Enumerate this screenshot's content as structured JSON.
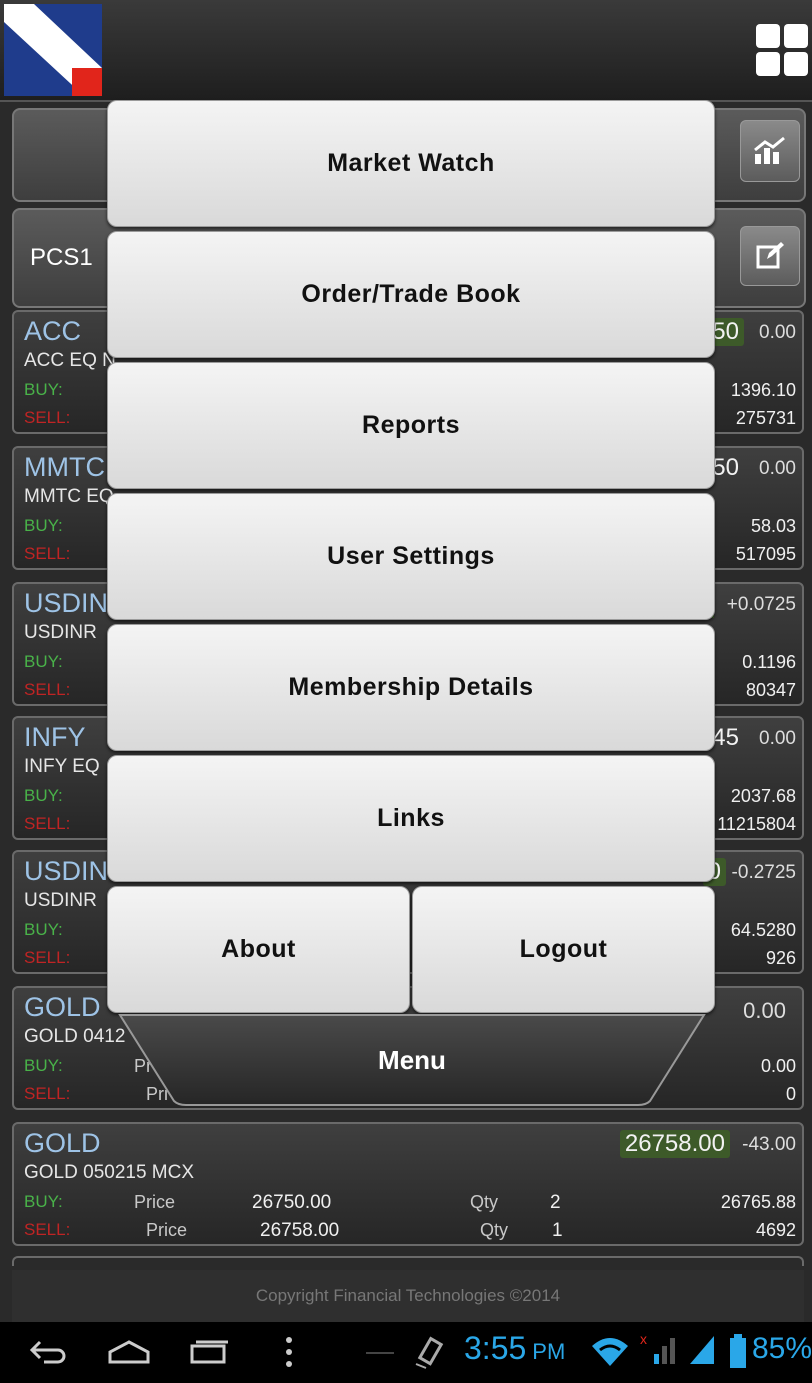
{
  "header": {
    "logo": "brand-logo",
    "menu_icon": "grid-icon"
  },
  "toolbar": {
    "chart_icon": "chart-icon",
    "edit_icon": "edit-icon",
    "watchlist_name": "PCS1"
  },
  "labels": {
    "buy": "BUY:",
    "sell": "SELL:",
    "price": "Price",
    "qty": "Qty"
  },
  "watchlist": [
    {
      "symbol": "ACC",
      "desc": "ACC EQ N",
      "ltp": ".50",
      "change": "0.00",
      "buy_right": "1396.10",
      "sell_right": "275731"
    },
    {
      "symbol": "MMTC",
      "desc": "MMTC EQ",
      "ltp": ".50",
      "change": "0.00",
      "buy_right": "58.03",
      "sell_right": "517095"
    },
    {
      "symbol": "USDIN",
      "desc": "USDINR",
      "ltp": "",
      "change": "+0.0725",
      "buy_right": "0.1196",
      "sell_right": "80347"
    },
    {
      "symbol": "INFY",
      "desc": "INFY EQ",
      "ltp": ".45",
      "change": "0.00",
      "buy_right": "2037.68",
      "sell_right": "11215804"
    },
    {
      "symbol": "USDIN",
      "desc": "USDINR",
      "ltp": "0",
      "change": "-0.2725",
      "buy_right": "64.5280",
      "sell_right": "926"
    },
    {
      "symbol": "GOLD",
      "desc": "GOLD 0412",
      "ltp": "",
      "change": "0.00",
      "buy_right": "0.00",
      "sell_right": "0",
      "buy_price_lbl": "Pr",
      "sell_price_lbl": "Pri"
    },
    {
      "symbol": "GOLD",
      "desc": "GOLD 050215 MCX",
      "ltp": "26758.00",
      "change": "-43.00",
      "buy_price": "26750.00",
      "buy_qty": "2",
      "buy_right": "26765.88",
      "sell_price": "26758.00",
      "sell_qty": "1",
      "sell_right": "4692"
    }
  ],
  "footer": {
    "copyright": "Copyright Financial Technologies ©2014"
  },
  "menu": {
    "items": [
      "Market Watch",
      "Order/Trade Book",
      "Reports",
      "User Settings",
      "Membership Details",
      "Links"
    ],
    "about": "About",
    "logout": "Logout",
    "tab_label": "Menu"
  },
  "statusbar": {
    "time": "3:55",
    "ampm": "PM",
    "battery": "85%",
    "icons": [
      "back-icon",
      "home-icon",
      "recents-icon",
      "overflow-icon",
      "vibrate-icon",
      "wifi-icon",
      "signal-icon",
      "battery-icon"
    ]
  }
}
